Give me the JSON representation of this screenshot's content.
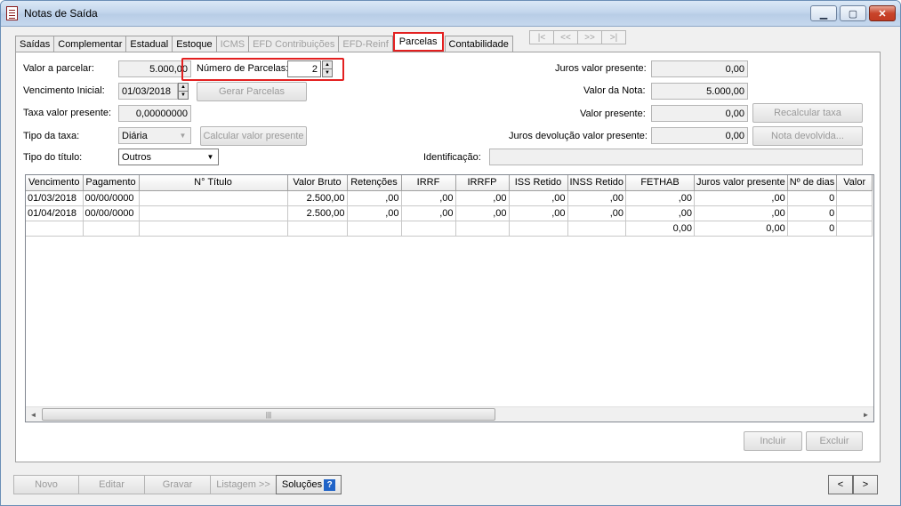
{
  "window": {
    "title": "Notas de Saída"
  },
  "titlebar": {
    "minimize": "▁",
    "maximize": "▢",
    "close": "✕"
  },
  "tabs": [
    {
      "label": "Saídas",
      "state": "normal"
    },
    {
      "label": "Complementar",
      "state": "normal"
    },
    {
      "label": "Estadual",
      "state": "normal"
    },
    {
      "label": "Estoque",
      "state": "normal"
    },
    {
      "label": "ICMS",
      "state": "disabled"
    },
    {
      "label": "EFD Contribuições",
      "state": "disabled"
    },
    {
      "label": "EFD-Reinf",
      "state": "disabled"
    },
    {
      "label": "Parcelas",
      "state": "active"
    },
    {
      "label": "Contabilidade",
      "state": "normal"
    }
  ],
  "record_nav": {
    "first": "|<",
    "prev": "<<",
    "next": ">>",
    "last": ">|"
  },
  "form": {
    "valor_parcelar": {
      "label": "Valor a parcelar:",
      "value": "5.000,00"
    },
    "numero_parcelas": {
      "label": "Número de Parcelas:",
      "value": "2"
    },
    "vencimento_inicial": {
      "label": "Vencimento Inicial:",
      "value": "01/03/2018"
    },
    "gerar_parcelas": "Gerar Parcelas",
    "taxa_valor_presente": {
      "label": "Taxa valor presente:",
      "value": "0,00000000"
    },
    "tipo_taxa": {
      "label": "Tipo da taxa:",
      "value": "Diária"
    },
    "calcular_valor_presente": "Calcular valor presente",
    "tipo_titulo": {
      "label": "Tipo do título:",
      "value": "Outros"
    },
    "juros_valor_presente": {
      "label": "Juros valor presente:",
      "value": "0,00"
    },
    "valor_nota": {
      "label": "Valor da Nota:",
      "value": "5.000,00"
    },
    "valor_presente": {
      "label": "Valor presente:",
      "value": "0,00"
    },
    "recalcular_taxa": "Recalcular taxa",
    "juros_devolucao": {
      "label": "Juros devolução valor presente:",
      "value": "0,00"
    },
    "nota_devolvida": "Nota devolvida...",
    "identificacao": {
      "label": "Identificação:",
      "value": ""
    }
  },
  "grid": {
    "columns": [
      "Vencimento",
      "Pagamento",
      "N° Título",
      "Valor Bruto",
      "Retenções",
      "IRRF",
      "IRRFP",
      "ISS Retido",
      "INSS Retido",
      "FETHAB",
      "Juros valor presente",
      "Nº de dias",
      "Valor"
    ],
    "rows": [
      [
        "01/03/2018",
        "00/00/0000",
        "",
        "2.500,00",
        ",00",
        ",00",
        ",00",
        ",00",
        ",00",
        ",00",
        ",00",
        "0",
        ""
      ],
      [
        "01/04/2018",
        "00/00/0000",
        "",
        "2.500,00",
        ",00",
        ",00",
        ",00",
        ",00",
        ",00",
        ",00",
        ",00",
        "0",
        ""
      ],
      [
        "",
        "",
        "",
        "",
        "",
        "",
        "",
        "",
        "",
        "0,00",
        "0,00",
        "0",
        ""
      ]
    ]
  },
  "grid_buttons": {
    "incluir": "Incluir",
    "excluir": "Excluir"
  },
  "bottom": {
    "novo": "Novo",
    "editar": "Editar",
    "gravar": "Gravar",
    "listagem": "Listagem >>",
    "solucoes": "Soluções",
    "help": "?",
    "prev": "<",
    "next": ">"
  }
}
